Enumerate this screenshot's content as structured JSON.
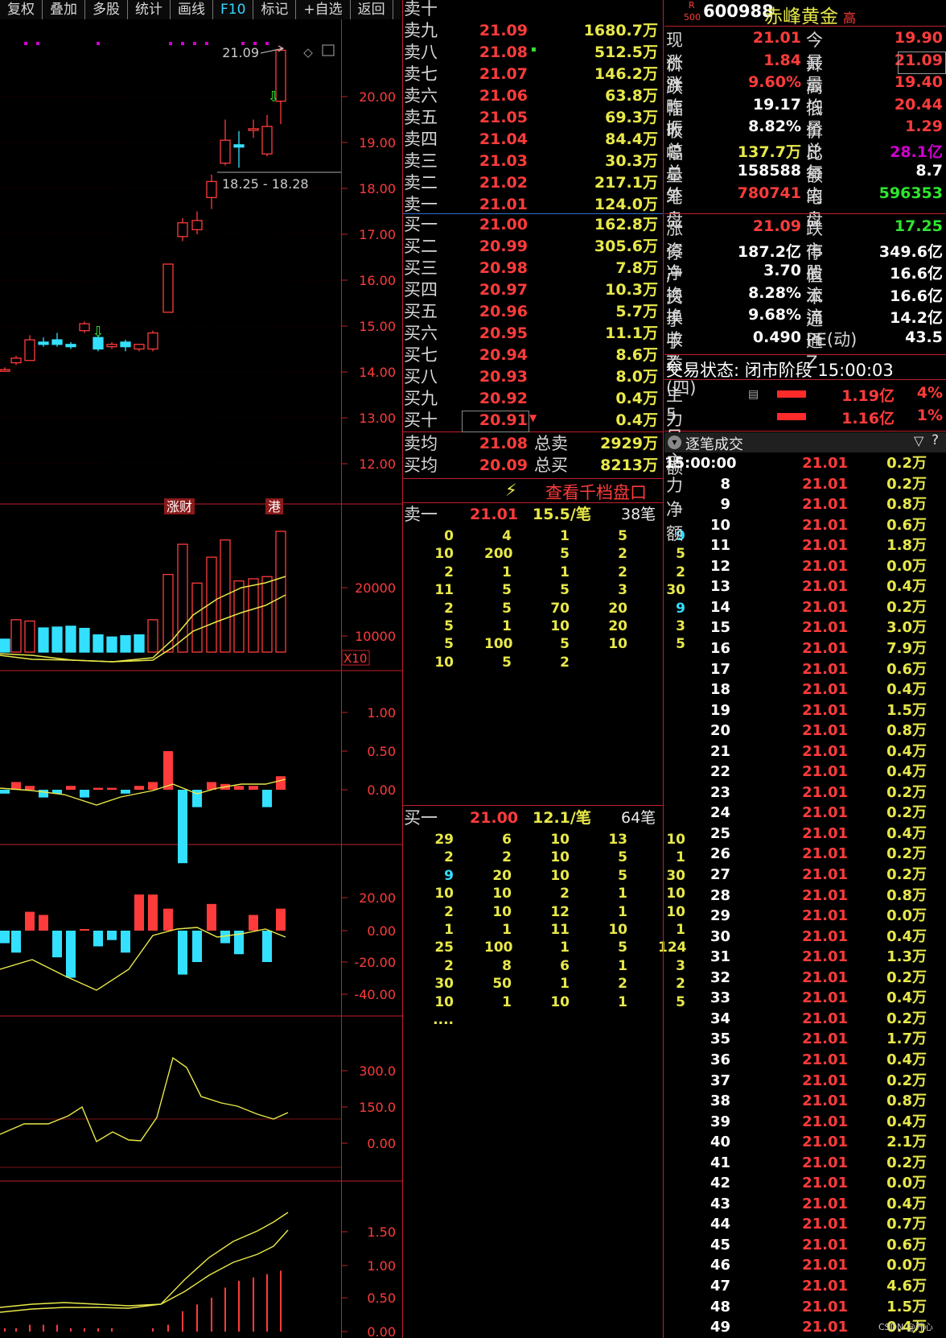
{
  "toolbar": {
    "items": [
      "复权",
      "叠加",
      "多股",
      "统计",
      "画线",
      "F10",
      "标记",
      "+自选",
      "返回"
    ]
  },
  "chart": {
    "price_labels": [
      "20.00",
      "19.00",
      "18.00",
      "17.00",
      "16.00",
      "15.00",
      "14.00",
      "13.00",
      "12.00"
    ],
    "high_label": "21.09",
    "range_label": "18.25 - 18.28",
    "event_tags": [
      "涨财",
      "港"
    ],
    "vol_labels": [
      "20000",
      "10000"
    ],
    "vol_unit": "X10",
    "macd_labels": [
      "1.00",
      "0.50",
      "0.00"
    ],
    "ind2_labels": [
      "20.00",
      "0.00",
      "-20.00",
      "-40.00"
    ],
    "ind3_labels": [
      "300.0",
      "150.0",
      "0.00"
    ],
    "ind4_labels": [
      "1.50",
      "1.00",
      "0.50",
      "0.00"
    ]
  },
  "orderbook": {
    "sell": [
      {
        "label": "卖十",
        "price": "",
        "vol": ""
      },
      {
        "label": "卖九",
        "price": "21.09",
        "vol": "1680.7万"
      },
      {
        "label": "卖八",
        "price": "21.08",
        "vol": "512.5万"
      },
      {
        "label": "卖七",
        "price": "21.07",
        "vol": "146.2万"
      },
      {
        "label": "卖六",
        "price": "21.06",
        "vol": "63.8万"
      },
      {
        "label": "卖五",
        "price": "21.05",
        "vol": "69.3万"
      },
      {
        "label": "卖四",
        "price": "21.04",
        "vol": "84.4万"
      },
      {
        "label": "卖三",
        "price": "21.03",
        "vol": "30.3万"
      },
      {
        "label": "卖二",
        "price": "21.02",
        "vol": "217.1万"
      },
      {
        "label": "卖一",
        "price": "21.01",
        "vol": "124.0万"
      }
    ],
    "buy": [
      {
        "label": "买一",
        "price": "21.00",
        "vol": "162.8万"
      },
      {
        "label": "买二",
        "price": "20.99",
        "vol": "305.6万"
      },
      {
        "label": "买三",
        "price": "20.98",
        "vol": "7.8万"
      },
      {
        "label": "买四",
        "price": "20.97",
        "vol": "10.3万"
      },
      {
        "label": "买五",
        "price": "20.96",
        "vol": "5.7万"
      },
      {
        "label": "买六",
        "price": "20.95",
        "vol": "11.1万"
      },
      {
        "label": "买七",
        "price": "20.94",
        "vol": "8.6万"
      },
      {
        "label": "买八",
        "price": "20.93",
        "vol": "8.0万"
      },
      {
        "label": "买九",
        "price": "20.92",
        "vol": "0.4万"
      },
      {
        "label": "买十",
        "price": "20.91",
        "vol": "0.4万"
      }
    ],
    "avg_sell_label": "卖均",
    "avg_sell": "21.08",
    "total_sell_label": "总卖",
    "total_sell": "2929万",
    "avg_buy_label": "买均",
    "avg_buy": "20.09",
    "total_buy_label": "总买",
    "total_buy": "8213万",
    "thousand_link": "查看千档盘口"
  },
  "sell_queue": {
    "label": "卖一",
    "price": "21.01",
    "per": "15.5/笔",
    "count": "38笔",
    "rows": [
      [
        "0",
        "4",
        "1",
        "5",
        "9"
      ],
      [
        "10",
        "200",
        "5",
        "2",
        "5"
      ],
      [
        "2",
        "1",
        "1",
        "2",
        "2"
      ],
      [
        "11",
        "5",
        "5",
        "3",
        "30"
      ],
      [
        "2",
        "5",
        "70",
        "20",
        "9"
      ],
      [
        "5",
        "1",
        "10",
        "20",
        "3"
      ],
      [
        "5",
        "100",
        "5",
        "10",
        "5"
      ],
      [
        "10",
        "5",
        "2"
      ]
    ]
  },
  "buy_queue": {
    "label": "买一",
    "price": "21.00",
    "per": "12.1/笔",
    "count": "64笔",
    "rows": [
      [
        "29",
        "6",
        "10",
        "13",
        "10"
      ],
      [
        "2",
        "2",
        "10",
        "5",
        "1"
      ],
      [
        "9",
        "20",
        "10",
        "5",
        "30"
      ],
      [
        "10",
        "10",
        "2",
        "1",
        "10"
      ],
      [
        "2",
        "10",
        "12",
        "1",
        "10"
      ],
      [
        "1",
        "1",
        "11",
        "10",
        "1"
      ],
      [
        "25",
        "100",
        "1",
        "5",
        "124"
      ],
      [
        "2",
        "8",
        "6",
        "1",
        "3"
      ],
      [
        "30",
        "50",
        "1",
        "2",
        "2"
      ],
      [
        "10",
        "1",
        "10",
        "1",
        "5"
      ]
    ],
    "more": "...."
  },
  "stock": {
    "badge_top": "R",
    "badge_bottom": "500",
    "code": "600988",
    "name": "赤峰黄金",
    "tag": "高"
  },
  "info": [
    {
      "l1": "现价",
      "v1": "21.01",
      "l2": "今开",
      "v2": "19.90"
    },
    {
      "l1": "涨跌",
      "v1": "1.84",
      "l2": "最高",
      "v2": "21.09"
    },
    {
      "l1": "涨幅",
      "v1": "9.60%",
      "l2": "最低",
      "v2": "19.40"
    },
    {
      "l1": "昨收",
      "v1": "19.17",
      "l2": "均价",
      "v2": "20.44"
    },
    {
      "l1": "振幅",
      "v1": "8.82%",
      "l2": "量比",
      "v2": "1.29"
    },
    {
      "l1": "总量",
      "v1": "137.7万",
      "l2": "总额",
      "v2": "28.1亿"
    },
    {
      "l1": "总笔",
      "v1": "158588",
      "l2": "每笔",
      "v2": "8.7"
    },
    {
      "l1": "外盘",
      "v1": "780741",
      "l2": "内盘",
      "v2": "596353"
    },
    {
      "l1": "涨停",
      "v1": "21.09",
      "l2": "跌停",
      "v2": "17.25"
    },
    {
      "l1": "资产",
      "v1": "187.2亿",
      "l2": "市值",
      "v2": "349.6亿"
    },
    {
      "l1": "净资",
      "v1": "3.70",
      "l2": "股本",
      "v2": "16.6亿"
    },
    {
      "l1": "换手",
      "v1": "8.28%",
      "l2": "流通",
      "v2": "16.6亿"
    },
    {
      "l1": "换手Z",
      "v1": "9.68%",
      "l2": "流通Z",
      "v2": "14.2亿"
    },
    {
      "l1": "收益(四)",
      "v1": "0.490",
      "l2": "PE(动)",
      "v2": "43.5"
    }
  ],
  "trade_status": "交易状态: 闭市阶段 15:00:03",
  "fund_flow": [
    {
      "label": "主力净额",
      "value": "1.19亿",
      "pct": "4%"
    },
    {
      "label": "5日主力净额",
      "value": "1.16亿",
      "pct": "1%"
    }
  ],
  "ticks_title": "逐笔成交",
  "ticks": [
    [
      "15:00:00",
      "21.01",
      "0.2万"
    ],
    [
      "8",
      "21.01",
      "0.2万"
    ],
    [
      "9",
      "21.01",
      "0.8万"
    ],
    [
      "10",
      "21.01",
      "0.6万"
    ],
    [
      "11",
      "21.01",
      "1.8万"
    ],
    [
      "12",
      "21.01",
      "0.0万"
    ],
    [
      "13",
      "21.01",
      "0.4万"
    ],
    [
      "14",
      "21.01",
      "0.2万"
    ],
    [
      "15",
      "21.01",
      "3.0万"
    ],
    [
      "16",
      "21.01",
      "7.9万"
    ],
    [
      "17",
      "21.01",
      "0.6万"
    ],
    [
      "18",
      "21.01",
      "0.4万"
    ],
    [
      "19",
      "21.01",
      "1.5万"
    ],
    [
      "20",
      "21.01",
      "0.8万"
    ],
    [
      "21",
      "21.01",
      "0.4万"
    ],
    [
      "22",
      "21.01",
      "0.4万"
    ],
    [
      "23",
      "21.01",
      "0.2万"
    ],
    [
      "24",
      "21.01",
      "0.2万"
    ],
    [
      "25",
      "21.01",
      "0.4万"
    ],
    [
      "26",
      "21.01",
      "0.2万"
    ],
    [
      "27",
      "21.01",
      "0.2万"
    ],
    [
      "28",
      "21.01",
      "0.8万"
    ],
    [
      "29",
      "21.01",
      "0.0万"
    ],
    [
      "30",
      "21.01",
      "0.4万"
    ],
    [
      "31",
      "21.01",
      "1.3万"
    ],
    [
      "32",
      "21.01",
      "0.2万"
    ],
    [
      "33",
      "21.01",
      "0.4万"
    ],
    [
      "34",
      "21.01",
      "0.2万"
    ],
    [
      "35",
      "21.01",
      "1.7万"
    ],
    [
      "36",
      "21.01",
      "0.4万"
    ],
    [
      "37",
      "21.01",
      "0.2万"
    ],
    [
      "38",
      "21.01",
      "0.8万"
    ],
    [
      "39",
      "21.01",
      "0.4万"
    ],
    [
      "40",
      "21.01",
      "2.1万"
    ],
    [
      "41",
      "21.01",
      "0.2万"
    ],
    [
      "42",
      "21.01",
      "0.0万"
    ],
    [
      "43",
      "21.01",
      "0.4万"
    ],
    [
      "44",
      "21.01",
      "0.7万"
    ],
    [
      "45",
      "21.01",
      "0.6万"
    ],
    [
      "46",
      "21.01",
      "0.0万"
    ],
    [
      "47",
      "21.01",
      "4.6万"
    ],
    [
      "48",
      "21.01",
      "1.5万"
    ],
    [
      "49",
      "21.01",
      "0.4万"
    ]
  ],
  "watermark": "CSDN @开心"
}
